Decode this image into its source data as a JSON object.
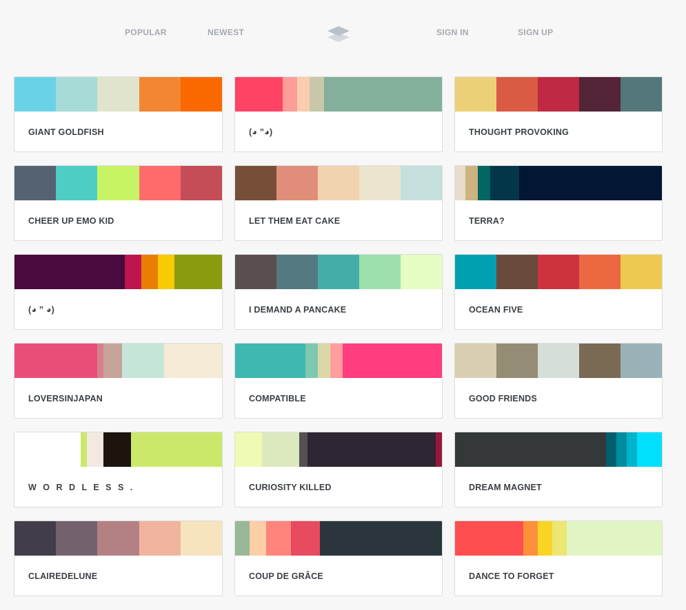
{
  "nav": {
    "popular": "POPULAR",
    "newest": "NEWEST",
    "sign_in": "SIGN IN",
    "sign_up": "SIGN UP",
    "logo_icon": "layers-icon"
  },
  "palettes": [
    {
      "title": "GIANT GOLDFISH",
      "colors": [
        "#69D2E7",
        "#A7DBD8",
        "#E0E4CC",
        "#F38630",
        "#FA6900"
      ],
      "widths": [
        20,
        20,
        20,
        20,
        20
      ]
    },
    {
      "title": "(◕ ”◕)",
      "colors": [
        "#FE4365",
        "#FC9D9A",
        "#F9CDAD",
        "#C8C8A9",
        "#83AF9B"
      ],
      "widths": [
        23,
        7,
        6,
        7,
        57
      ]
    },
    {
      "title": "THOUGHT PROVOKING",
      "colors": [
        "#ECD078",
        "#D95B43",
        "#C02942",
        "#542437",
        "#53777A"
      ],
      "widths": [
        20,
        20,
        20,
        20,
        20
      ]
    },
    {
      "title": "CHEER UP EMO KID",
      "colors": [
        "#556270",
        "#4ECDC4",
        "#C7F464",
        "#FF6B6B",
        "#C44D58"
      ],
      "widths": [
        20,
        20,
        20,
        20,
        20
      ]
    },
    {
      "title": "LET THEM EAT CAKE",
      "colors": [
        "#774F38",
        "#E08E79",
        "#F1D4AF",
        "#ECE5CE",
        "#C5E0DC"
      ],
      "widths": [
        20,
        20,
        20,
        20,
        20
      ]
    },
    {
      "title": "TERRA?",
      "colors": [
        "#E8DDCB",
        "#CDB380",
        "#036564",
        "#033649",
        "#031634"
      ],
      "widths": [
        5,
        6,
        6,
        14,
        69
      ]
    },
    {
      "title": "(◕ ” ◕)",
      "colors": [
        "#490A3D",
        "#BD1550",
        "#E97F02",
        "#F8CA00",
        "#8A9B0F"
      ],
      "widths": [
        53,
        8,
        8,
        8,
        23
      ]
    },
    {
      "title": "I DEMAND A PANCAKE",
      "colors": [
        "#594F4F",
        "#547980",
        "#45ADA8",
        "#9DE0AD",
        "#E5FCC2"
      ],
      "widths": [
        20,
        20,
        20,
        20,
        20
      ]
    },
    {
      "title": "OCEAN FIVE",
      "colors": [
        "#00A0B0",
        "#6A4A3C",
        "#CC333F",
        "#EB6841",
        "#EDC951"
      ],
      "widths": [
        20,
        20,
        20,
        20,
        20
      ]
    },
    {
      "title": "LOVERSINJAPAN",
      "colors": [
        "#E94E77",
        "#D68189",
        "#C6A49A",
        "#C6E5D9",
        "#F4EAD5"
      ],
      "widths": [
        40,
        3,
        9,
        20,
        28
      ]
    },
    {
      "title": "COMPATIBLE",
      "colors": [
        "#3FB8AF",
        "#7FC7AF",
        "#DAD8A7",
        "#FF9E9D",
        "#FF3D7F"
      ],
      "widths": [
        34,
        6,
        6,
        6,
        48
      ]
    },
    {
      "title": "GOOD FRIENDS",
      "colors": [
        "#D9CEB2",
        "#948C75",
        "#D5DED9",
        "#7A6A53",
        "#99B2B7"
      ],
      "widths": [
        20,
        20,
        20,
        20,
        20
      ]
    },
    {
      "title": "W O R D L E S S .",
      "colors": [
        "#FFFFFF",
        "#CBE86B",
        "#F2E9E1",
        "#1C140D",
        "#CBE86B"
      ],
      "widths": [
        32,
        3,
        8,
        13,
        44
      ]
    },
    {
      "title": "CURIOSITY KILLED",
      "colors": [
        "#EFFAB4",
        "#DCE9BE",
        "#555152",
        "#2E2633",
        "#99173C"
      ],
      "widths": [
        13,
        18,
        4,
        62,
        3
      ]
    },
    {
      "title": "DREAM MAGNET",
      "colors": [
        "#343838",
        "#005F6B",
        "#008C9E",
        "#00B4CC",
        "#00DFFC"
      ],
      "widths": [
        73,
        5,
        5,
        5,
        12
      ]
    },
    {
      "title": "CLAIREDELUNE",
      "colors": [
        "#413E4A",
        "#73626E",
        "#B38184",
        "#F0B49E",
        "#F7E4BE"
      ],
      "widths": [
        20,
        20,
        20,
        20,
        20
      ]
    },
    {
      "title": "COUP DE GRÂCE",
      "colors": [
        "#99B898",
        "#FECEA8",
        "#FF847C",
        "#E84A5F",
        "#2A363B"
      ],
      "widths": [
        7,
        8,
        12,
        14,
        59
      ]
    },
    {
      "title": "DANCE TO FORGET",
      "colors": [
        "#FF4E50",
        "#FC913A",
        "#F9D423",
        "#EDE574",
        "#E1F5C4"
      ],
      "widths": [
        33,
        7,
        7,
        7,
        46
      ]
    }
  ]
}
